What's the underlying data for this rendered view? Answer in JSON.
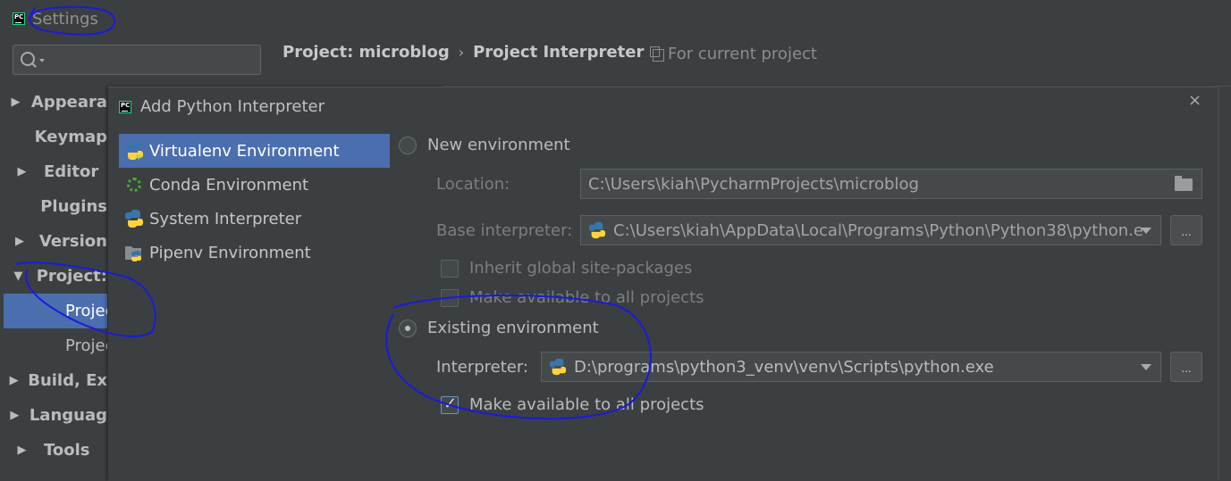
{
  "settings": {
    "title": "Settings",
    "breadcrumb": {
      "project": "Project: microblog",
      "separator": "›",
      "page": "Project Interpreter"
    },
    "scope_note": "For current project",
    "nav": [
      {
        "label": "Appeara",
        "arrow": "▶"
      },
      {
        "label": "Keymap",
        "arrow": ""
      },
      {
        "label": "Editor",
        "arrow": "▶"
      },
      {
        "label": "Plugins",
        "arrow": ""
      },
      {
        "label": "Version",
        "arrow": "▶"
      },
      {
        "label": "Project:",
        "arrow": "▼"
      },
      {
        "label": "Projec",
        "arrow": ""
      },
      {
        "label": "Projec",
        "arrow": ""
      },
      {
        "label": "Build, Ex",
        "arrow": "▶"
      },
      {
        "label": "Languag",
        "arrow": "▶"
      },
      {
        "label": "Tools",
        "arrow": "▶"
      }
    ]
  },
  "dialog": {
    "title": "Add Python Interpreter",
    "close_glyph": "×",
    "env_types": [
      {
        "label": "Virtualenv Environment",
        "icon": "python-venv-icon",
        "selected": true
      },
      {
        "label": "Conda Environment",
        "icon": "conda-icon",
        "selected": false
      },
      {
        "label": "System Interpreter",
        "icon": "python-icon",
        "selected": false
      },
      {
        "label": "Pipenv Environment",
        "icon": "pipenv-icon",
        "selected": false
      }
    ],
    "new_env": {
      "radio_label": "New environment",
      "selected": false,
      "location_label": "Location:",
      "location_value": "C:\\Users\\kiah\\PycharmProjects\\microblog",
      "base_label": "Base interpreter:",
      "base_value": "C:\\Users\\kiah\\AppData\\Local\\Programs\\Python\\Python38\\python.e",
      "inherit_label": "Inherit global site-packages",
      "inherit_checked": false,
      "available_label": "Make available to all projects",
      "available_checked": false
    },
    "existing_env": {
      "radio_label": "Existing environment",
      "selected": true,
      "interpreter_label": "Interpreter:",
      "interpreter_value": "D:\\programs\\python3_venv\\venv\\Scripts\\python.exe",
      "available_label": "Make available to all projects",
      "available_checked": true
    },
    "browse_label": "..."
  },
  "colors": {
    "background": "#3c3f41",
    "selection": "#4b6eaf",
    "annotation_ink": "#1a1adc"
  }
}
